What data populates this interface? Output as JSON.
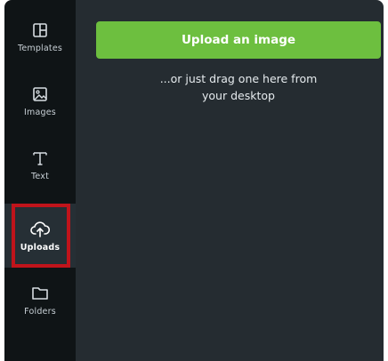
{
  "sidebar": {
    "items": [
      {
        "label": "Templates",
        "icon": "templates-icon"
      },
      {
        "label": "Images",
        "icon": "image-icon"
      },
      {
        "label": "Text",
        "icon": "text-icon"
      },
      {
        "label": "Uploads",
        "icon": "upload-cloud-icon",
        "active": true
      },
      {
        "label": "Folders",
        "icon": "folder-icon"
      }
    ]
  },
  "panel": {
    "upload_button_label": "Upload an image",
    "drag_hint_line1": "...or just drag one here from",
    "drag_hint_line2": "your desktop"
  },
  "colors": {
    "sidebar_bg": "#0f1416",
    "panel_bg": "#252c31",
    "upload_button": "#6dbf3f",
    "highlight": "#c0141b"
  }
}
